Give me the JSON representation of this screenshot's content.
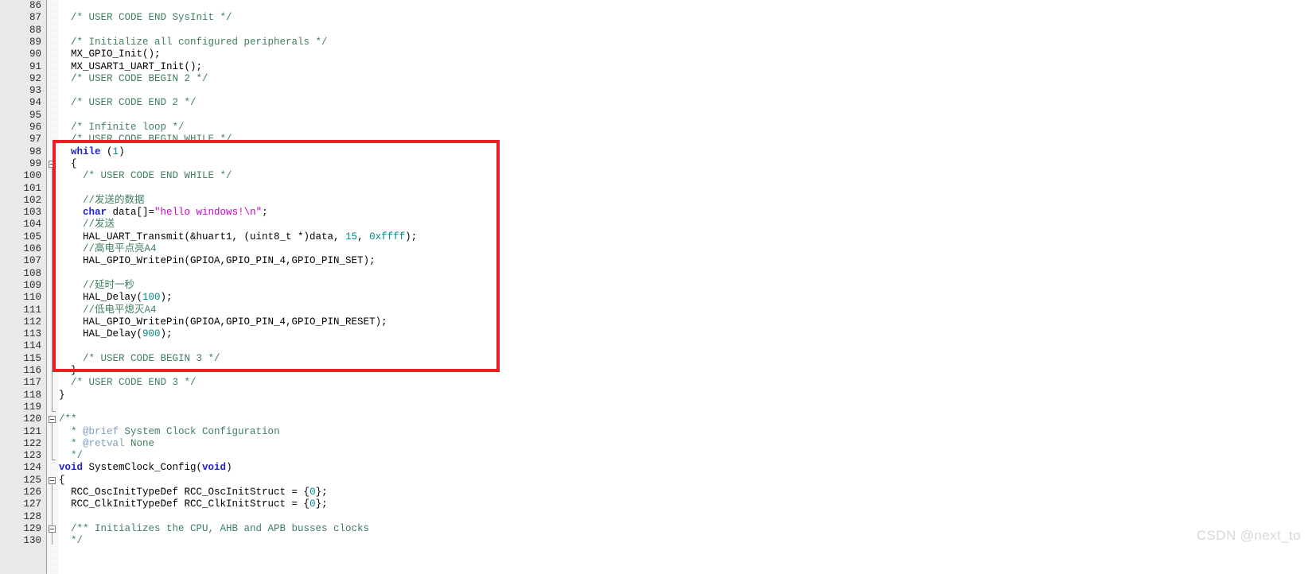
{
  "editor": {
    "first_line": 86,
    "watermark": "CSDN @next_to",
    "accent_highlight_color": "#ee1c25",
    "gutter_color": "#e9e9e9",
    "comment_color": "#3f7f5f",
    "keyword_color": "#2222cc",
    "string_color": "#cc00cc",
    "number_color": "#008b8b"
  },
  "lines": [
    {
      "n": "86",
      "segs": []
    },
    {
      "n": "87",
      "segs": [
        {
          "t": "  /* USER CODE END SysInit */",
          "c": "cm"
        }
      ]
    },
    {
      "n": "88",
      "segs": []
    },
    {
      "n": "89",
      "segs": [
        {
          "t": "  /* Initialize all configured peripherals */",
          "c": "cm"
        }
      ]
    },
    {
      "n": "90",
      "segs": [
        {
          "t": "  MX_GPIO_Init();",
          "c": "pl"
        }
      ]
    },
    {
      "n": "91",
      "segs": [
        {
          "t": "  MX_USART1_UART_Init();",
          "c": "pl"
        }
      ]
    },
    {
      "n": "92",
      "segs": [
        {
          "t": "  /* USER CODE BEGIN 2 */",
          "c": "cm"
        }
      ]
    },
    {
      "n": "93",
      "segs": []
    },
    {
      "n": "94",
      "segs": [
        {
          "t": "  /* USER CODE END 2 */",
          "c": "cm"
        }
      ]
    },
    {
      "n": "95",
      "segs": []
    },
    {
      "n": "96",
      "segs": [
        {
          "t": "  /* Infinite loop */",
          "c": "cm"
        }
      ]
    },
    {
      "n": "97",
      "segs": [
        {
          "t": "  /* USER CODE BEGIN WHILE */",
          "c": "cm"
        }
      ]
    },
    {
      "n": "98",
      "segs": [
        {
          "t": "  ",
          "c": "pl"
        },
        {
          "t": "while",
          "c": "kw"
        },
        {
          "t": " (",
          "c": "pl"
        },
        {
          "t": "1",
          "c": "num"
        },
        {
          "t": ")",
          "c": "pl"
        }
      ]
    },
    {
      "n": "99",
      "segs": [
        {
          "t": "  {",
          "c": "pl"
        }
      ]
    },
    {
      "n": "100",
      "segs": [
        {
          "t": "    /* USER CODE END WHILE */",
          "c": "cm"
        }
      ]
    },
    {
      "n": "101",
      "segs": []
    },
    {
      "n": "102",
      "segs": [
        {
          "t": "    //发送的数据",
          "c": "cm"
        }
      ]
    },
    {
      "n": "103",
      "segs": [
        {
          "t": "    ",
          "c": "pl"
        },
        {
          "t": "char",
          "c": "kw"
        },
        {
          "t": " data[]=",
          "c": "pl"
        },
        {
          "t": "\"hello windows!\\n\"",
          "c": "str"
        },
        {
          "t": ";",
          "c": "pl"
        }
      ]
    },
    {
      "n": "104",
      "segs": [
        {
          "t": "    //发送",
          "c": "cm"
        }
      ]
    },
    {
      "n": "105",
      "segs": [
        {
          "t": "    HAL_UART_Transmit(&huart1, (uint8_t *)data, ",
          "c": "pl"
        },
        {
          "t": "15",
          "c": "num"
        },
        {
          "t": ", ",
          "c": "pl"
        },
        {
          "t": "0xffff",
          "c": "num"
        },
        {
          "t": ");",
          "c": "pl"
        }
      ]
    },
    {
      "n": "106",
      "segs": [
        {
          "t": "    //高电平点亮A4",
          "c": "cm"
        }
      ]
    },
    {
      "n": "107",
      "segs": [
        {
          "t": "    HAL_GPIO_WritePin(GPIOA,GPIO_PIN_4,GPIO_PIN_SET);",
          "c": "pl"
        }
      ]
    },
    {
      "n": "108",
      "segs": []
    },
    {
      "n": "109",
      "segs": [
        {
          "t": "    //延时一秒",
          "c": "cm"
        }
      ]
    },
    {
      "n": "110",
      "segs": [
        {
          "t": "    HAL_Delay(",
          "c": "pl"
        },
        {
          "t": "100",
          "c": "num"
        },
        {
          "t": ");",
          "c": "pl"
        }
      ]
    },
    {
      "n": "111",
      "segs": [
        {
          "t": "    //低电平熄灭A4",
          "c": "cm"
        }
      ]
    },
    {
      "n": "112",
      "segs": [
        {
          "t": "    HAL_GPIO_WritePin(GPIOA,GPIO_PIN_4,GPIO_PIN_RESET);",
          "c": "pl"
        }
      ]
    },
    {
      "n": "113",
      "segs": [
        {
          "t": "    HAL_Delay(",
          "c": "pl"
        },
        {
          "t": "900",
          "c": "num"
        },
        {
          "t": ");",
          "c": "pl"
        }
      ]
    },
    {
      "n": "114",
      "segs": []
    },
    {
      "n": "115",
      "segs": [
        {
          "t": "    /* USER CODE BEGIN 3 */",
          "c": "cm"
        }
      ]
    },
    {
      "n": "116",
      "segs": [
        {
          "t": "  }",
          "c": "pl"
        }
      ]
    },
    {
      "n": "117",
      "segs": [
        {
          "t": "  /* USER CODE END 3 */",
          "c": "cm"
        }
      ]
    },
    {
      "n": "118",
      "segs": [
        {
          "t": "}",
          "c": "pl"
        }
      ]
    },
    {
      "n": "119",
      "segs": []
    },
    {
      "n": "120",
      "segs": [
        {
          "t": "/**",
          "c": "cm"
        }
      ]
    },
    {
      "n": "121",
      "segs": [
        {
          "t": "  * ",
          "c": "cm"
        },
        {
          "t": "@brief",
          "c": "an"
        },
        {
          "t": " System Clock Configuration",
          "c": "cm"
        }
      ]
    },
    {
      "n": "122",
      "segs": [
        {
          "t": "  * ",
          "c": "cm"
        },
        {
          "t": "@retval",
          "c": "an"
        },
        {
          "t": " None",
          "c": "cm"
        }
      ]
    },
    {
      "n": "123",
      "segs": [
        {
          "t": "  */",
          "c": "cm"
        }
      ]
    },
    {
      "n": "124",
      "segs": [
        {
          "t": "",
          "c": "pl"
        },
        {
          "t": "void",
          "c": "kw"
        },
        {
          "t": " SystemClock_Config(",
          "c": "pl"
        },
        {
          "t": "void",
          "c": "kw"
        },
        {
          "t": ")",
          "c": "pl"
        }
      ]
    },
    {
      "n": "125",
      "segs": [
        {
          "t": "{",
          "c": "pl"
        }
      ]
    },
    {
      "n": "126",
      "segs": [
        {
          "t": "  RCC_OscInitTypeDef RCC_OscInitStruct = {",
          "c": "pl"
        },
        {
          "t": "0",
          "c": "num"
        },
        {
          "t": "};",
          "c": "pl"
        }
      ]
    },
    {
      "n": "127",
      "segs": [
        {
          "t": "  RCC_ClkInitTypeDef RCC_ClkInitStruct = {",
          "c": "pl"
        },
        {
          "t": "0",
          "c": "num"
        },
        {
          "t": "};",
          "c": "pl"
        }
      ]
    },
    {
      "n": "128",
      "segs": []
    },
    {
      "n": "129",
      "segs": [
        {
          "t": "  /** Initializes the CPU, AHB and APB busses clocks",
          "c": "cm"
        }
      ]
    },
    {
      "n": "130",
      "segs": [
        {
          "t": "  */",
          "c": "cm"
        }
      ]
    }
  ],
  "fold_markers": [
    {
      "line": "99",
      "type": "minus"
    },
    {
      "line": "120",
      "type": "minus"
    },
    {
      "line": "125",
      "type": "minus"
    },
    {
      "line": "129",
      "type": "minus"
    }
  ]
}
